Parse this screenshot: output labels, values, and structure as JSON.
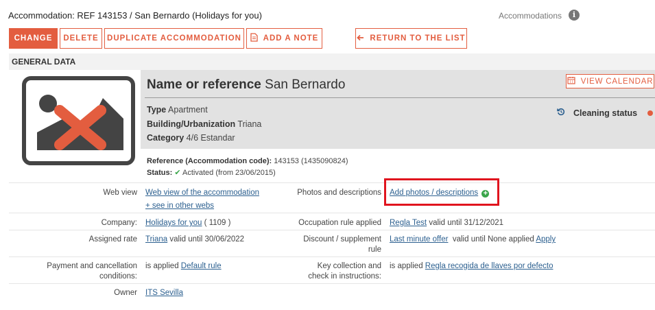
{
  "header": {
    "title": "Accommodation: REF 143153 / San Bernardo (Holidays for you)",
    "section": "Accommodations",
    "info_glyph": "i"
  },
  "toolbar": {
    "change": "CHANGE",
    "delete": "DELETE",
    "duplicate": "DUPLICATE ACCOMMODATION",
    "add_note": "ADD A NOTE",
    "return": "RETURN TO THE LIST"
  },
  "general": {
    "header": "GENERAL DATA",
    "name_label": "Name or reference",
    "name_value": "San Bernardo",
    "view_calendar": "VIEW CALENDAR",
    "type_label": "Type",
    "type_value": "Apartment",
    "building_label": "Building/Urbanization",
    "building_value": "Triana",
    "category_label": "Category",
    "category_value": "4/6 Estandar",
    "cleaning_label": "Cleaning status",
    "reference_label": "Reference (Accommodation code):",
    "reference_value": "143153 (1435090824)",
    "status_label": "Status:",
    "status_value": "Activated (from 23/06/2015)"
  },
  "details": {
    "web_view_label": "Web view",
    "web_view_link": "Web view of the accommodation",
    "see_other": "+ see in other webs",
    "photos_label": "Photos and descriptions",
    "photos_link": "Add photos / descriptions",
    "company_label": "Company:",
    "company_link": "Holidays for you",
    "company_id": "( 1109 )",
    "occupation_label": "Occupation rule applied",
    "occupation_link": "Regla Test",
    "occupation_valid": "valid until 31/12/2021",
    "rate_label": "Assigned rate",
    "rate_link": "Triana",
    "rate_valid": "valid until 30/06/2022",
    "discount_label_1": "Discount / supplement",
    "discount_label_2": "rule",
    "discount_link": "Last minute offer",
    "discount_valid": "valid until None applied",
    "discount_apply": "Apply",
    "payment_label_1": "Payment and cancellation",
    "payment_label_2": "conditions:",
    "payment_prefix": "is applied",
    "payment_link": "Default rule",
    "key_label_1": "Key collection and",
    "key_label_2": "check in instructions:",
    "key_prefix": "is applied",
    "key_link": "Regla recogida de llaves por defecto",
    "owner_label": "Owner",
    "owner_link": "ITS Sevilla"
  },
  "colors": {
    "accent": "#e35d3f",
    "link": "#2b5f8f",
    "highlight": "#e0141e",
    "success": "#3aa54a"
  },
  "icons": [
    "info-icon",
    "note-icon",
    "arrow-left-icon",
    "calendar-icon",
    "history-icon",
    "status-dot-icon",
    "check-icon",
    "plus-circle-icon",
    "no-image-icon"
  ]
}
